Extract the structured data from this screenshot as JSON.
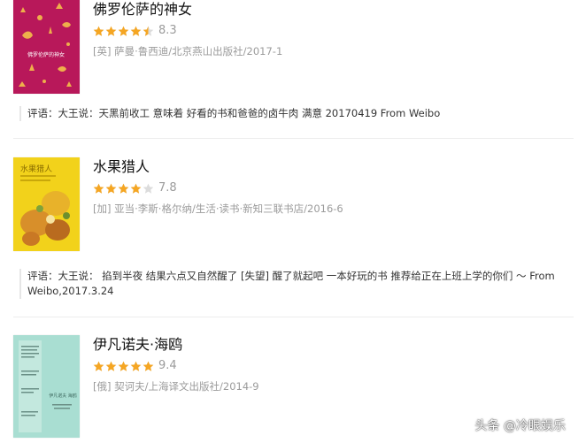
{
  "books": [
    {
      "title": "佛罗伦萨的神女",
      "score": "8.3",
      "stars": 4.5,
      "meta": "[英] 萨曼·鲁西迪/北京燕山出版社/2017-1",
      "comment": "评语：大王说：天黑前收工 意味着 好看的书和爸爸的卤牛肉 满意 20170419 From Weibo",
      "cover_text": "佛罗伦萨的神女"
    },
    {
      "title": "水果猎人",
      "score": "7.8",
      "stars": 4,
      "meta": "[加] 亚当·李斯·格尔纳/生活·读书·新知三联书店/2016-6",
      "comment": "评语：大王说： 掐到半夜 结果六点又自然醒了 [失望] 醒了就起吧 一本好玩的书 推荐给正在上班上学的你们 ～ From Weibo,2017.3.24",
      "cover_text": "水果猎人"
    },
    {
      "title": "伊凡诺夫·海鸥",
      "score": "9.4",
      "stars": 5,
      "meta": "[俄] 契诃夫/上海译文出版社/2014-9",
      "comment": "",
      "cover_text": "伊凡诺夫 海鸥"
    }
  ],
  "watermark": "头条 @冷眼娱乐",
  "colors": {
    "star": "#f5a623",
    "star_empty": "#dcdcdc",
    "text_muted": "#9b9b9b"
  }
}
